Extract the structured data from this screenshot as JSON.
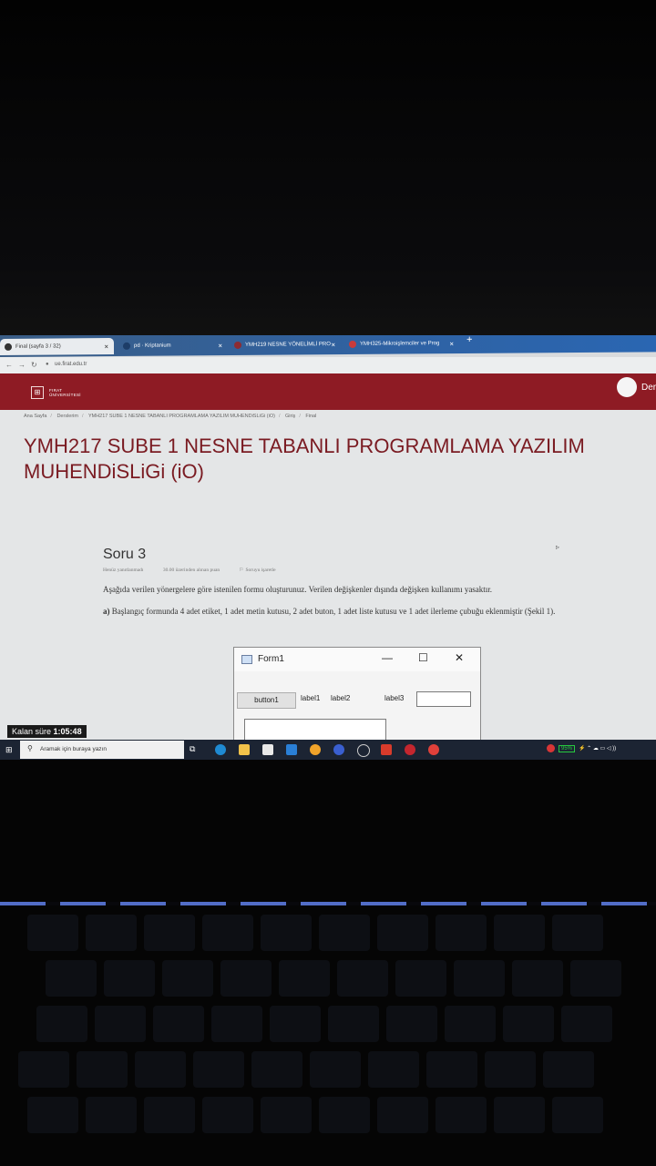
{
  "browser": {
    "tabs": [
      {
        "label": "Final (sayfa 3 / 32)",
        "active": true
      },
      {
        "label": "pd · Kriptanium",
        "active": false
      },
      {
        "label": "YMH219 NESNE YÖNELİMLİ PRO",
        "active": false
      },
      {
        "label": "YMH325-Mikroişlemciler ve Prog",
        "active": false
      }
    ],
    "new_tab": "+",
    "close": "×",
    "url": "ue.firat.edu.tr"
  },
  "header": {
    "logo_line1": "FIRAT",
    "logo_line2": "ÜNİVERSİTESİ",
    "user": "Der"
  },
  "breadcrumb": [
    "Ana Sayfa",
    "Derslerim",
    "YMH217 SUBE 1 NESNE TABANLI PROGRAMLAMA YAZILIM MUHENDiSLiGi (iO)",
    "Giriş",
    "Final"
  ],
  "course_title": "YMH217 SUBE 1 NESNE TABANLI PROGRAMLAMA YAZILIM MUHENDiSLiGi (iO)",
  "question": {
    "title": "Soru 3",
    "status": "Henüz yanıtlanmadı",
    "points": "30.00 üzerinden alınan puan",
    "flag": "Soruyu işaretle",
    "text": "Aşağıda verilen yönergelere göre istenilen formu oluşturunuz. Verilen değişkenler dışında değişken kullanımı yasaktır.",
    "part_a_label": "a)",
    "part_a": "Başlangıç formunda 4 adet etiket, 1 adet metin kutusu, 2 adet buton, 1 adet liste kutusu ve 1 adet ilerleme çubuğu eklenmiştir (Şekil 1)."
  },
  "form": {
    "title": "Form1",
    "button1": "button1",
    "label1": "label1",
    "label2": "label2",
    "label3": "label3"
  },
  "timer": {
    "label": "Kalan süre",
    "value": "1:05:48"
  },
  "taskbar": {
    "search_placeholder": "Aramak için buraya yazın",
    "battery": "95%"
  }
}
